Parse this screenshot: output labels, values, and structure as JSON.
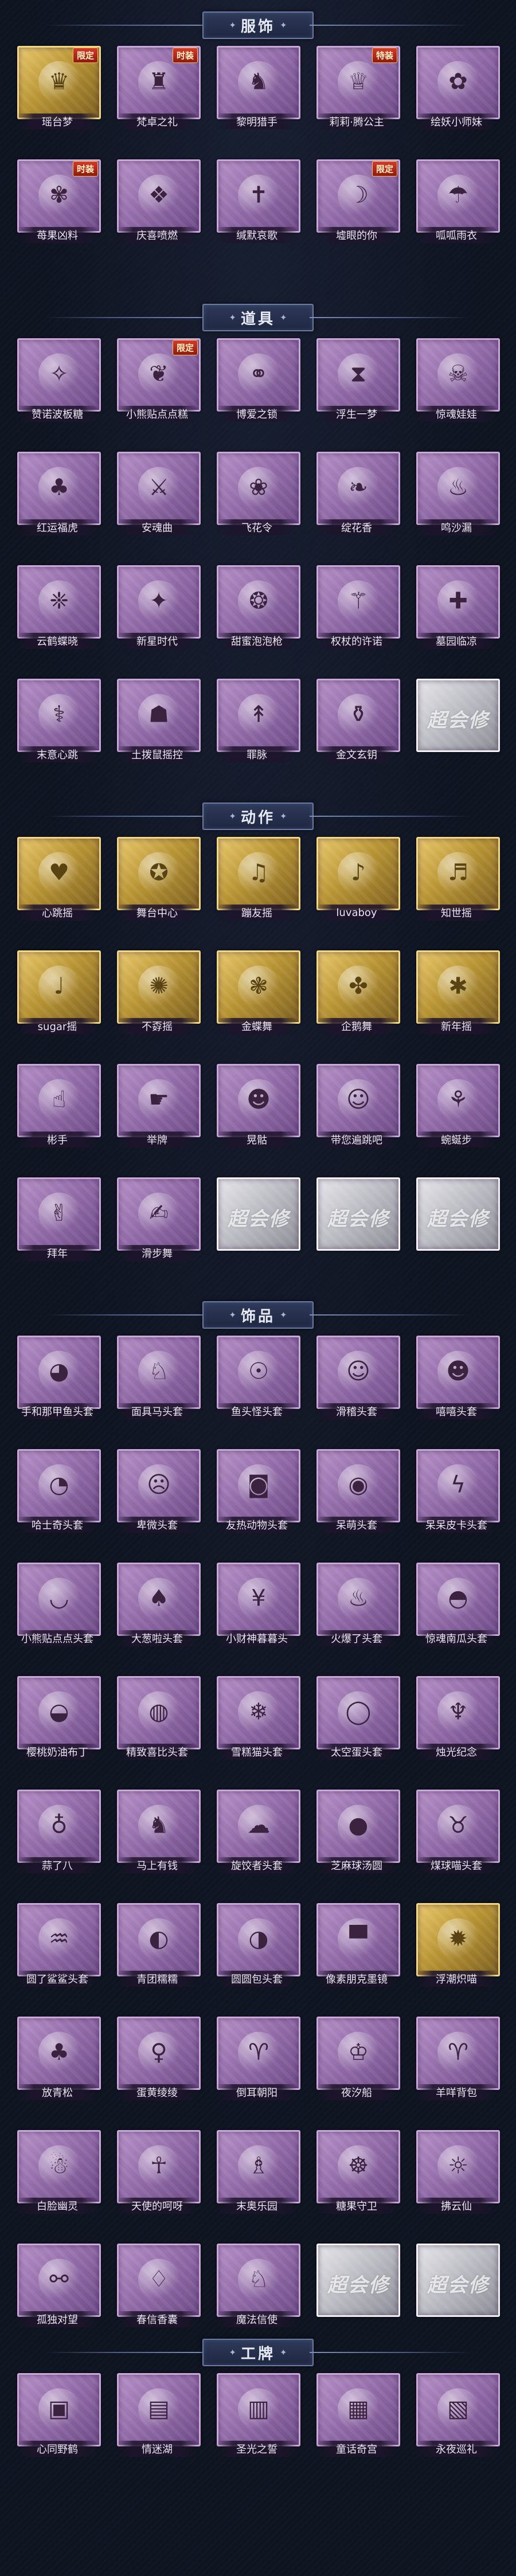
{
  "sections": [
    {
      "title": "服饰",
      "items": [
        {
          "label": "瑶台梦",
          "tier": "gold",
          "icon": "gown-icon",
          "glyph": "♛",
          "badge": "限定"
        },
        {
          "label": "梵卓之礼",
          "tier": "purple",
          "icon": "vampire-costume-icon",
          "glyph": "♜",
          "badge": "时装"
        },
        {
          "label": "黎明猎手",
          "tier": "purple",
          "icon": "hunter-costume-icon",
          "glyph": "♞"
        },
        {
          "label": "莉莉·腾公主",
          "tier": "purple",
          "icon": "princess-costume-icon",
          "glyph": "♕",
          "badge": "特装"
        },
        {
          "label": "绘妖小师妹",
          "tier": "purple",
          "icon": "painter-costume-icon",
          "glyph": "✿"
        },
        {
          "label": "苺果凶料",
          "tier": "purple",
          "icon": "berry-costume-icon",
          "glyph": "✾",
          "badge": "时装"
        },
        {
          "label": "庆喜喷燃",
          "tier": "purple",
          "icon": "festive-costume-icon",
          "glyph": "❖"
        },
        {
          "label": "缄默哀歌",
          "tier": "purple",
          "icon": "elegy-costume-icon",
          "glyph": "✝"
        },
        {
          "label": "墟眼的你",
          "tier": "purple",
          "icon": "witch-hat-costume-icon",
          "glyph": "☽",
          "badge": "限定"
        },
        {
          "label": "呱呱雨衣",
          "tier": "purple",
          "icon": "raincoat-costume-icon",
          "glyph": "☂"
        }
      ]
    },
    {
      "title": "道具",
      "items": [
        {
          "label": "赞诺波板糖",
          "tier": "purple",
          "icon": "lollipop-wand-icon",
          "glyph": "✧"
        },
        {
          "label": "小熊贴点点糕",
          "tier": "purple",
          "icon": "cake-icon",
          "glyph": "❦",
          "badge": "限定"
        },
        {
          "label": "博爱之锁",
          "tier": "purple",
          "icon": "chain-icon",
          "glyph": "⚭"
        },
        {
          "label": "浮生一梦",
          "tier": "purple",
          "icon": "hourglass-icon",
          "glyph": "⧗"
        },
        {
          "label": "惊魂娃娃",
          "tier": "purple",
          "icon": "skull-mask-icon",
          "glyph": "☠"
        },
        {
          "label": "红运福虎",
          "tier": "purple",
          "icon": "tiger-toy-icon",
          "glyph": "♣"
        },
        {
          "label": "安魂曲",
          "tier": "purple",
          "icon": "scythe-icon",
          "glyph": "⚔"
        },
        {
          "label": "飞花令",
          "tier": "purple",
          "icon": "flower-fan-icon",
          "glyph": "❀"
        },
        {
          "label": "绽花香",
          "tier": "purple",
          "icon": "antler-branch-icon",
          "glyph": "❧"
        },
        {
          "label": "鸣沙漏",
          "tier": "purple",
          "icon": "lantern-icon",
          "glyph": "♨"
        },
        {
          "label": "云鹤蝶晓",
          "tier": "purple",
          "icon": "crane-wings-icon",
          "glyph": "❈"
        },
        {
          "label": "新星时代",
          "tier": "purple",
          "icon": "pistol-icon",
          "glyph": "✦"
        },
        {
          "label": "甜蜜泡泡枪",
          "tier": "purple",
          "icon": "bubble-gun-icon",
          "glyph": "❂"
        },
        {
          "label": "权杖的许诺",
          "tier": "purple",
          "icon": "scepter-icon",
          "glyph": "⚚"
        },
        {
          "label": "墓园临凉",
          "tier": "purple",
          "icon": "first-aid-kit-icon",
          "glyph": "✚"
        },
        {
          "label": "末意心跳",
          "tier": "purple",
          "icon": "staff-icon",
          "glyph": "⚕"
        },
        {
          "label": "土拨鼠摇控",
          "tier": "purple",
          "icon": "groundhog-icon",
          "glyph": "☗"
        },
        {
          "label": "罪脉",
          "tier": "purple",
          "icon": "spear-icon",
          "glyph": "↟"
        },
        {
          "label": "金文玄钥",
          "tier": "purple",
          "icon": "bottle-icon",
          "glyph": "⚱"
        },
        {
          "label": "",
          "tier": "silver",
          "icon": "placeholder-card-icon",
          "placeholder": "超会修"
        }
      ]
    },
    {
      "title": "动作",
      "items": [
        {
          "label": "心跳摇",
          "tier": "gold",
          "icon": "figure-dance-icon",
          "glyph": "♥"
        },
        {
          "label": "舞台中心",
          "tier": "gold",
          "icon": "figure-dance-icon",
          "glyph": "✪"
        },
        {
          "label": "蹦友摇",
          "tier": "gold",
          "icon": "figure-dance-icon",
          "glyph": "♫"
        },
        {
          "label": "luvaboy",
          "tier": "gold",
          "icon": "figure-dance-icon",
          "glyph": "♪"
        },
        {
          "label": "知世摇",
          "tier": "gold",
          "icon": "figure-dance-icon",
          "glyph": "♬"
        },
        {
          "label": "sugar摇",
          "tier": "gold",
          "icon": "figure-dance-icon",
          "glyph": "♩"
        },
        {
          "label": "不孬摇",
          "tier": "gold",
          "icon": "figure-dance-icon",
          "glyph": "✺"
        },
        {
          "label": "金蝶舞",
          "tier": "gold",
          "icon": "figure-dance-icon",
          "glyph": "❃"
        },
        {
          "label": "企鹅舞",
          "tier": "gold",
          "icon": "figure-dance-icon",
          "glyph": "✤"
        },
        {
          "label": "新年摇",
          "tier": "gold",
          "icon": "figure-dance-icon",
          "glyph": "✱"
        },
        {
          "label": "彬手",
          "tier": "purple",
          "icon": "figure-pose-icon",
          "glyph": "☝"
        },
        {
          "label": "举牌",
          "tier": "purple",
          "icon": "figure-pose-icon",
          "glyph": "☛"
        },
        {
          "label": "晃骷",
          "tier": "purple",
          "icon": "figure-pose-icon",
          "glyph": "☻"
        },
        {
          "label": "带您遍跳吧",
          "tier": "purple",
          "icon": "figure-pose-icon",
          "glyph": "☺"
        },
        {
          "label": "蜿蜒步",
          "tier": "purple",
          "icon": "figure-pose-icon",
          "glyph": "⚘"
        },
        {
          "label": "拜年",
          "tier": "purple",
          "icon": "figure-pose-icon",
          "glyph": "✌"
        },
        {
          "label": "滑步舞",
          "tier": "purple",
          "icon": "figure-pose-icon",
          "glyph": "✍"
        },
        {
          "label": "",
          "tier": "silver",
          "icon": "placeholder-card-icon",
          "placeholder": "超会修"
        },
        {
          "label": "",
          "tier": "silver",
          "icon": "placeholder-card-icon",
          "placeholder": "超会修"
        },
        {
          "label": "",
          "tier": "silver",
          "icon": "placeholder-card-icon",
          "placeholder": "超会修"
        }
      ]
    },
    {
      "title": "饰品",
      "items": [
        {
          "label": "手和那甲鱼头套",
          "tier": "purple",
          "icon": "whale-head-icon",
          "glyph": "◕"
        },
        {
          "label": "面具马头套",
          "tier": "purple",
          "icon": "horse-head-icon",
          "glyph": "♘"
        },
        {
          "label": "鱼头怪头套",
          "tier": "purple",
          "icon": "fish-head-icon",
          "glyph": "☉"
        },
        {
          "label": "滑稽头套",
          "tier": "purple",
          "icon": "smiley-head-icon",
          "glyph": "☺"
        },
        {
          "label": "嘻嘻头套",
          "tier": "purple",
          "icon": "grin-head-icon",
          "glyph": "☻"
        },
        {
          "label": "哈士奇头套",
          "tier": "purple",
          "icon": "dog-head-icon",
          "glyph": "◔"
        },
        {
          "label": "卑微头套",
          "tier": "purple",
          "icon": "sad-face-icon",
          "glyph": "☹"
        },
        {
          "label": "友热动物头套",
          "tier": "purple",
          "icon": "monster-head-icon",
          "glyph": "◙"
        },
        {
          "label": "呆萌头套",
          "tier": "purple",
          "icon": "derp-face-icon",
          "glyph": "◉"
        },
        {
          "label": "呆呆皮卡头套",
          "tier": "purple",
          "icon": "pika-head-icon",
          "glyph": "ϟ"
        },
        {
          "label": "小熊贴点点头套",
          "tier": "purple",
          "icon": "blob-head-icon",
          "glyph": "◡"
        },
        {
          "label": "大葱啦头套",
          "tier": "purple",
          "icon": "leek-head-icon",
          "glyph": "♠"
        },
        {
          "label": "小财神暮暮头",
          "tier": "purple",
          "icon": "money-bag-icon",
          "glyph": "¥"
        },
        {
          "label": "火爆了头套",
          "tier": "purple",
          "icon": "fire-head-icon",
          "glyph": "♨"
        },
        {
          "label": "惊魂南瓜头套",
          "tier": "purple",
          "icon": "pumpkin-head-icon",
          "glyph": "◓"
        },
        {
          "label": "樱桃奶油布丁",
          "tier": "purple",
          "icon": "pudding-icon",
          "glyph": "◒"
        },
        {
          "label": "精致喜比头套",
          "tier": "purple",
          "icon": "pink-creature-icon",
          "glyph": "◍"
        },
        {
          "label": "雪糕猫头套",
          "tier": "purple",
          "icon": "snow-cat-icon",
          "glyph": "❄"
        },
        {
          "label": "太空蛋头套",
          "tier": "purple",
          "icon": "egg-head-icon",
          "glyph": "◯"
        },
        {
          "label": "烛光纪念",
          "tier": "purple",
          "icon": "candle-icon",
          "glyph": "♆"
        },
        {
          "label": "蒜了八",
          "tier": "purple",
          "icon": "garlic-icon",
          "glyph": "♁"
        },
        {
          "label": "马上有钱",
          "tier": "purple",
          "icon": "horse-toy-icon",
          "glyph": "♞"
        },
        {
          "label": "旋饺者头套",
          "tier": "purple",
          "icon": "cloud-head-icon",
          "glyph": "☁"
        },
        {
          "label": "芝麻球汤圆",
          "tier": "purple",
          "icon": "rice-ball-icon",
          "glyph": "●"
        },
        {
          "label": "煤球喵头套",
          "tier": "purple",
          "icon": "black-cat-icon",
          "glyph": "♉"
        },
        {
          "label": "圆了鲨鲨头套",
          "tier": "purple",
          "icon": "shark-head-icon",
          "glyph": "♒"
        },
        {
          "label": "青团糯糯",
          "tier": "purple",
          "icon": "green-bun-icon",
          "glyph": "◐"
        },
        {
          "label": "圆圆包头套",
          "tier": "purple",
          "icon": "bun-head-icon",
          "glyph": "◑"
        },
        {
          "label": "像素朋克墨镜",
          "tier": "purple",
          "icon": "pixel-sunglasses-icon",
          "glyph": "▀"
        },
        {
          "label": "浮潮炽喵",
          "tier": "gold",
          "icon": "bright-cat-icon",
          "glyph": "✹"
        },
        {
          "label": "放青松",
          "tier": "purple",
          "icon": "bonsai-icon",
          "glyph": "♣"
        },
        {
          "label": "蛋黄绫绫",
          "tier": "purple",
          "icon": "chick-icon",
          "glyph": "♀"
        },
        {
          "label": "倒耳朝阳",
          "tier": "purple",
          "icon": "headband-icon",
          "glyph": "♈"
        },
        {
          "label": "夜汐船",
          "tier": "purple",
          "icon": "crystal-crown-icon",
          "glyph": "♔"
        },
        {
          "label": "羊咩背包",
          "tier": "purple",
          "icon": "sheep-backpack-icon",
          "glyph": "♈"
        },
        {
          "label": "白脸幽灵",
          "tier": "purple",
          "icon": "ghost-icon",
          "glyph": "☃"
        },
        {
          "label": "天使的呵呀",
          "tier": "purple",
          "icon": "angel-doll-icon",
          "glyph": "☥"
        },
        {
          "label": "末奥乐园",
          "tier": "purple",
          "icon": "clown-doll-icon",
          "glyph": "♗"
        },
        {
          "label": "糖果守卫",
          "tier": "purple",
          "icon": "charm-pendant-icon",
          "glyph": "☸"
        },
        {
          "label": "拂云仙",
          "tier": "purple",
          "icon": "fairy-pendant-icon",
          "glyph": "☼"
        },
        {
          "label": "孤独对望",
          "tier": "purple",
          "icon": "hanging-charm-icon",
          "glyph": "⚯"
        },
        {
          "label": "春信香囊",
          "tier": "purple",
          "icon": "sachet-icon",
          "glyph": "♢"
        },
        {
          "label": "魔法信使",
          "tier": "purple",
          "icon": "rabbit-doll-icon",
          "glyph": "♘"
        },
        {
          "label": "",
          "tier": "silver",
          "icon": "placeholder-card-icon",
          "placeholder": "超会修"
        },
        {
          "label": "",
          "tier": "silver",
          "icon": "placeholder-card-icon",
          "placeholder": "超会修"
        }
      ]
    },
    {
      "title": "工牌",
      "items": [
        {
          "label": "心同野鹤",
          "tier": "purple",
          "icon": "badge-card-icon",
          "glyph": "▣"
        },
        {
          "label": "情迷湖",
          "tier": "purple",
          "icon": "badge-card-icon",
          "glyph": "▤"
        },
        {
          "label": "圣光之誓",
          "tier": "purple",
          "icon": "badge-card-icon",
          "glyph": "▥"
        },
        {
          "label": "童话奇宫",
          "tier": "purple",
          "icon": "badge-card-icon",
          "glyph": "▦"
        },
        {
          "label": "永夜巡礼",
          "tier": "purple",
          "icon": "badge-card-icon",
          "glyph": "▧"
        }
      ]
    }
  ]
}
